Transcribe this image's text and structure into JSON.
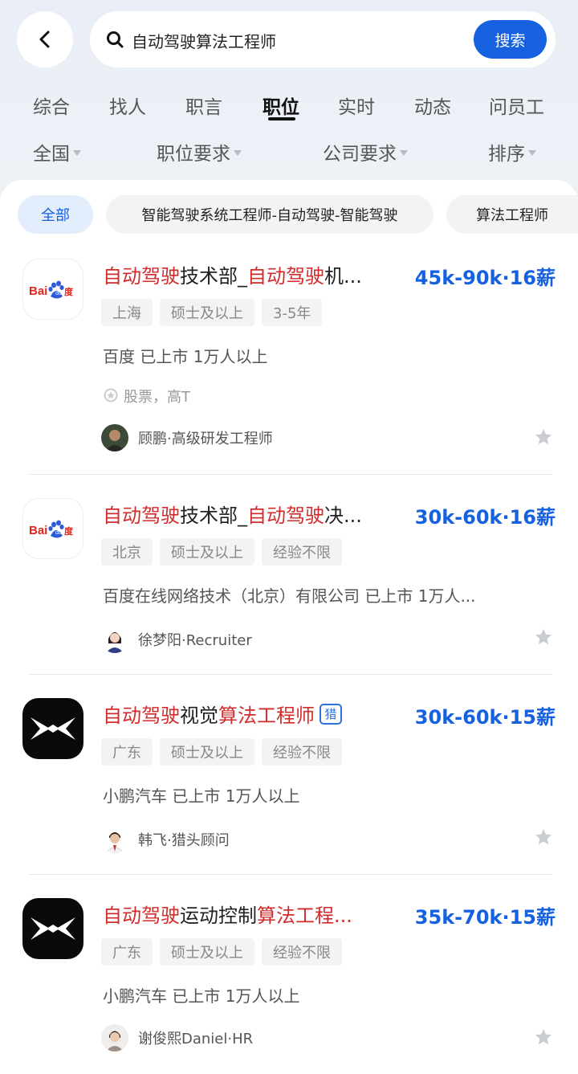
{
  "search": {
    "query": "自动驾驶算法工程师",
    "button_label": "搜索"
  },
  "tabs": [
    {
      "label": "综合"
    },
    {
      "label": "找人"
    },
    {
      "label": "职言"
    },
    {
      "label": "职位",
      "active": true
    },
    {
      "label": "实时"
    },
    {
      "label": "动态"
    },
    {
      "label": "问员工"
    }
  ],
  "filters": [
    {
      "label": "全国"
    },
    {
      "label": "职位要求"
    },
    {
      "label": "公司要求"
    },
    {
      "label": "排序"
    }
  ],
  "chips": [
    {
      "label": "全部",
      "active": true
    },
    {
      "label": "智能驾驶系统工程师-自动驾驶-智能驾驶"
    },
    {
      "label": "算法工程师"
    }
  ],
  "jobs": [
    {
      "logo": "baidu-logo",
      "title_parts": [
        {
          "text": "自动驾驶",
          "hl": true
        },
        {
          "text": "技术部_",
          "hl": false
        },
        {
          "text": "自动驾驶",
          "hl": true
        },
        {
          "text": "机...",
          "hl": false
        }
      ],
      "salary": "45k-90k·16薪",
      "tags": [
        "上海",
        "硕士及以上",
        "3-5年"
      ],
      "company": "百度 已上市 1万人以上",
      "perk": "股票，高T",
      "recruiter": "顾鹏·高级研发工程师",
      "avatar": "recruiter-avatar-1"
    },
    {
      "logo": "baidu-logo",
      "title_parts": [
        {
          "text": "自动驾驶",
          "hl": true
        },
        {
          "text": "技术部_",
          "hl": false
        },
        {
          "text": "自动驾驶",
          "hl": true
        },
        {
          "text": "决...",
          "hl": false
        }
      ],
      "salary": "30k-60k·16薪",
      "tags": [
        "北京",
        "硕士及以上",
        "经验不限"
      ],
      "company": "百度在线网络技术（北京）有限公司 已上市 1万人...",
      "recruiter": "徐梦阳·Recruiter",
      "avatar": "recruiter-avatar-2"
    },
    {
      "logo": "xpeng-logo",
      "title_parts": [
        {
          "text": "自动驾驶",
          "hl": true
        },
        {
          "text": "视觉",
          "hl": false
        },
        {
          "text": "算法工程师",
          "hl": true
        }
      ],
      "badge": "猎",
      "salary": "30k-60k·15薪",
      "tags": [
        "广东",
        "硕士及以上",
        "经验不限"
      ],
      "company": "小鹏汽车 已上市 1万人以上",
      "recruiter": "韩飞·猎头顾问",
      "avatar": "recruiter-avatar-3"
    },
    {
      "logo": "xpeng-logo",
      "title_parts": [
        {
          "text": "自动驾驶",
          "hl": true
        },
        {
          "text": "运动控制",
          "hl": false
        },
        {
          "text": "算法工程...",
          "hl": true
        }
      ],
      "salary": "35k-70k·15薪",
      "tags": [
        "广东",
        "硕士及以上",
        "经验不限"
      ],
      "company": "小鹏汽车 已上市 1万人以上",
      "recruiter": "谢俊熙Daniel·HR",
      "avatar": "recruiter-avatar-4"
    }
  ],
  "colors": {
    "accent": "#1561e0",
    "highlight": "#d22b2b",
    "salary": "#1561e0"
  }
}
